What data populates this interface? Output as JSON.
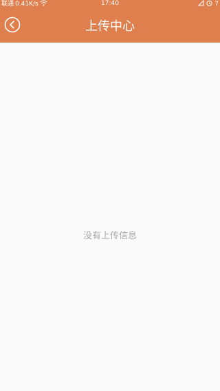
{
  "status_bar": {
    "carrier": "联通",
    "net_speed": "0.41K/s",
    "time": "17:40",
    "battery": "7",
    "icons": [
      "wifi-icon",
      "signal-icon",
      "alarm-icon"
    ]
  },
  "nav": {
    "title": "上传中心",
    "back_icon": "back-circle-icon"
  },
  "main": {
    "empty_message": "没有上传信息"
  },
  "colors": {
    "header": "#e07f4e",
    "background": "#fafafa",
    "empty_text": "#a9a9a9"
  }
}
